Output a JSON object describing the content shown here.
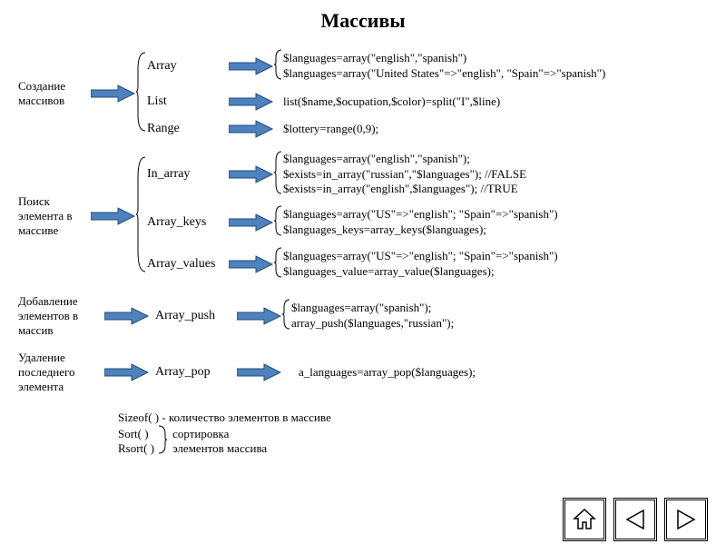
{
  "title": "Массивы",
  "sections": [
    {
      "label": "Создание массивов",
      "items": [
        {
          "name": "Array",
          "code": [
            "$languages=array(\"english\",\"spanish\")",
            "$languages=array(\"United States\"=>\"english\", \"Spain\"=>\"spanish\")"
          ]
        },
        {
          "name": "List",
          "code": [
            "list($name,$ocupation,$color)=split(\"I\",$line)"
          ]
        },
        {
          "name": "Range",
          "code": [
            "$lottery=range(0,9);"
          ]
        }
      ]
    },
    {
      "label": "Поиск элемента в массиве",
      "items": [
        {
          "name": "In_array",
          "code": [
            "$languages=array(\"english\",\"spanish\");",
            "$exists=in_array(\"russian\",\"$languages\"); //FALSE",
            "$exists=in_array(\"english\",$languages\"); //TRUE"
          ]
        },
        {
          "name": "Array_keys",
          "code": [
            "$languages=array(\"US\"=>\"english\"; \"Spain\"=>\"spanish\")",
            "$languages_keys=array_keys($languages);"
          ]
        },
        {
          "name": "Array_values",
          "code": [
            "$languages=array(\"US\"=>\"english\"; \"Spain\"=>\"spanish\")",
            "$languages_value=array_value($languages);"
          ]
        }
      ]
    },
    {
      "label": "Добавление элементов в массив",
      "items": [
        {
          "name": "Array_push",
          "code": [
            "$languages=array(\"spanish\");",
            "array_push($languages,\"russian\");"
          ]
        }
      ]
    },
    {
      "label": "Удаление последнего элемента",
      "items": [
        {
          "name": "Array_pop",
          "code": [
            "a_languages=array_pop($languages);"
          ]
        }
      ]
    }
  ],
  "notes": {
    "sizeof": "Sizeof( ) - количество элементов в массиве",
    "sort": "Sort( )",
    "rsort": "Rsort( )",
    "sort_desc": "сортировка",
    "rsort_desc": "элементов массива"
  },
  "nav": {
    "home": "home-icon",
    "prev": "prev-icon",
    "next": "next-icon"
  }
}
